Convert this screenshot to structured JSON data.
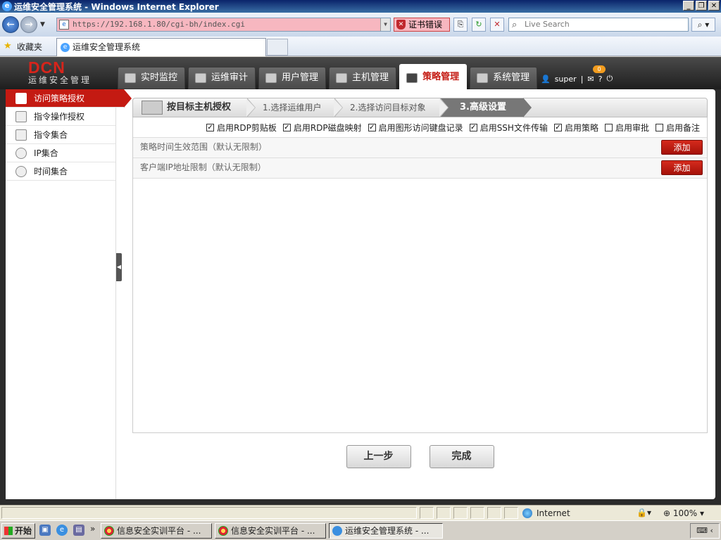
{
  "browser": {
    "window_title": "运维安全管理系统 - Windows Internet Explorer",
    "url": "https://192.168.1.80/cgi-bh/index.cgi",
    "cert_error": "证书错误",
    "search_placeholder": "Live Search",
    "favorites_label": "收藏夹",
    "tab_title": "运维安全管理系统"
  },
  "app": {
    "logo": "DCN",
    "logo_subtitle": "运维安全管理",
    "nav": [
      {
        "label": "实时监控"
      },
      {
        "label": "运维审计"
      },
      {
        "label": "用户管理"
      },
      {
        "label": "主机管理"
      },
      {
        "label": "策略管理",
        "active": true
      },
      {
        "label": "系统管理"
      }
    ],
    "user": "super",
    "message_count": "0",
    "help": "?"
  },
  "sidebar": {
    "items": [
      {
        "label": "访问策略授权",
        "active": true
      },
      {
        "label": "指令操作授权"
      },
      {
        "label": "指令集合"
      },
      {
        "label": "IP集合"
      },
      {
        "label": "时间集合"
      }
    ]
  },
  "wizard": {
    "title": "按目标主机授权",
    "steps": [
      "1.选择运维用户",
      "2.选择访问目标对象",
      "3.高级设置"
    ],
    "options": [
      {
        "label": "启用RDP剪贴板",
        "checked": true
      },
      {
        "label": "启用RDP磁盘映射",
        "checked": true
      },
      {
        "label": "启用图形访问键盘记录",
        "checked": true
      },
      {
        "label": "启用SSH文件传输",
        "checked": true
      },
      {
        "label": "启用策略",
        "checked": true
      },
      {
        "label": "启用审批",
        "checked": false
      },
      {
        "label": "启用备注",
        "checked": false
      }
    ],
    "rows": [
      {
        "label": "策略时间生效范围（默认无限制）",
        "button": "添加"
      },
      {
        "label": "客户端IP地址限制（默认无限制）",
        "button": "添加"
      }
    ],
    "prev_button": "上一步",
    "finish_button": "完成"
  },
  "statusbar": {
    "zone": "Internet",
    "zoom": "100%"
  },
  "taskbar": {
    "start": "开始",
    "tasks": [
      {
        "label": "信息安全实训平台 - ..."
      },
      {
        "label": "信息安全实训平台 - ..."
      },
      {
        "label": "运维安全管理系统 - ...",
        "active": true
      }
    ]
  }
}
